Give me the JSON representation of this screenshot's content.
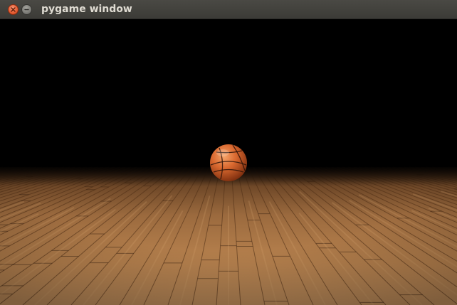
{
  "window": {
    "title": "pygame window",
    "controls": [
      {
        "name": "close-button",
        "icon": "close-icon"
      },
      {
        "name": "minimize-button",
        "icon": "minimize-icon"
      }
    ]
  },
  "scene": {
    "background": "#000000",
    "floor": {
      "description_icon": "hardwood-court-floor",
      "wood_color": "#b07a48"
    },
    "ball": {
      "icon": "basketball-icon",
      "color": "#d9682f"
    }
  }
}
